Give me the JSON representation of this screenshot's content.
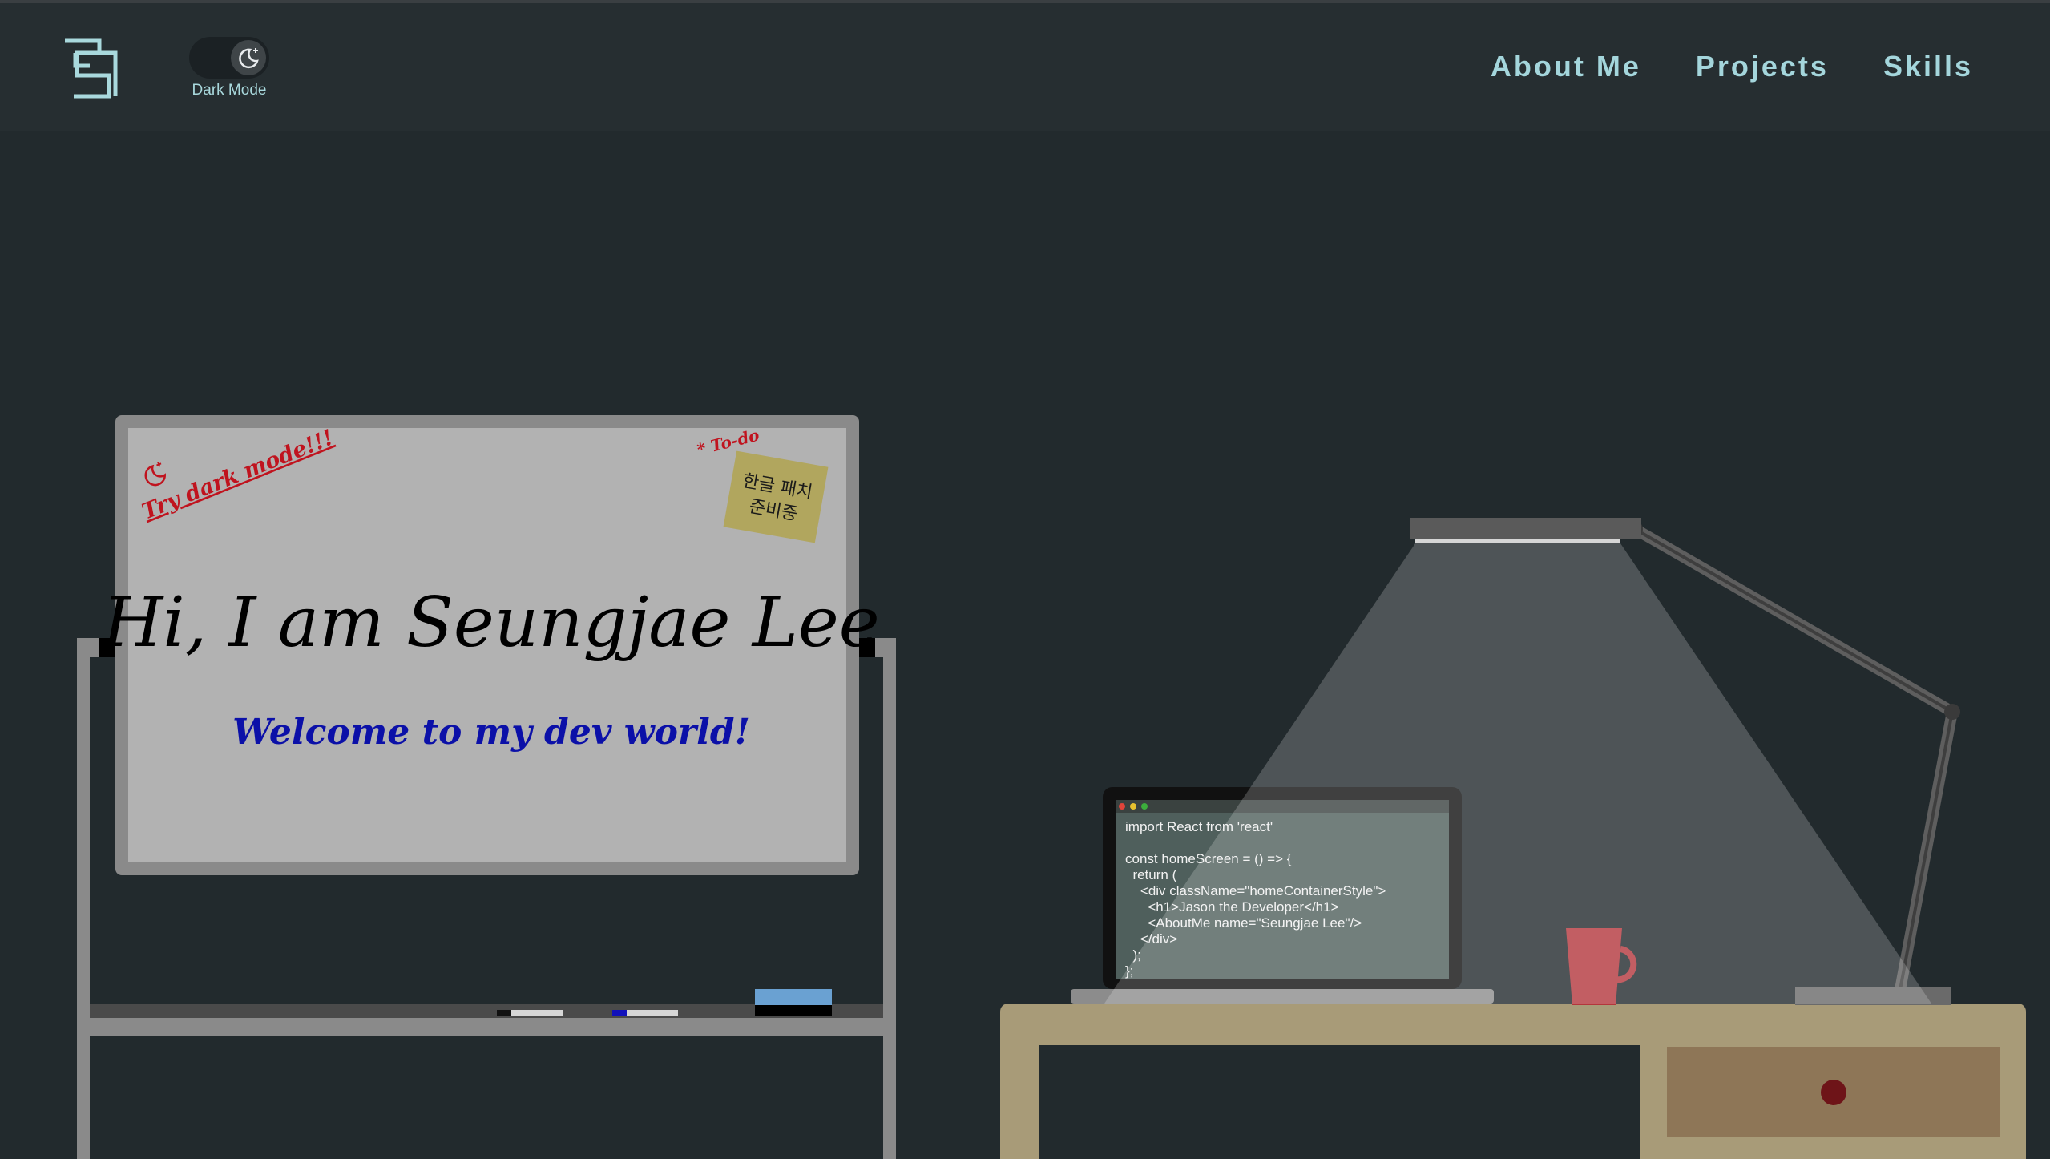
{
  "nav": {
    "toggle_label": "Dark Mode",
    "links": [
      "About Me",
      "Projects",
      "Skills"
    ]
  },
  "whiteboard": {
    "heading": "Hi, I am Seungjae Lee",
    "subheading": "Welcome to my dev world!",
    "note_try": "Try dark mode!!!",
    "todo_label": "* To-do",
    "sticky_line1": "한글 패치",
    "sticky_line2": "준비중"
  },
  "laptop": {
    "code_lines": [
      "import React from 'react'",
      "",
      "const homeScreen = () => {",
      "  return (",
      "    <div className=\"homeContainerStyle\">",
      "      <h1>Jason the Developer</h1>",
      "      <AboutMe name=\"Seungjae Lee\"/>",
      "    </div>",
      "  );",
      "};"
    ]
  },
  "colors": {
    "background": "#222a2d",
    "navbar": "#262e31",
    "nav_link": "#a4d6dc",
    "board_heading": "#000000",
    "board_subheading": "#0b10a8",
    "note_red": "#c0131e",
    "sticky": "#b1a65e",
    "desk": "#a89b78",
    "mug": "#b3363c"
  },
  "icons": {
    "logo": "logo-icon",
    "toggle": "moon-icon",
    "note": "moon-icon"
  }
}
